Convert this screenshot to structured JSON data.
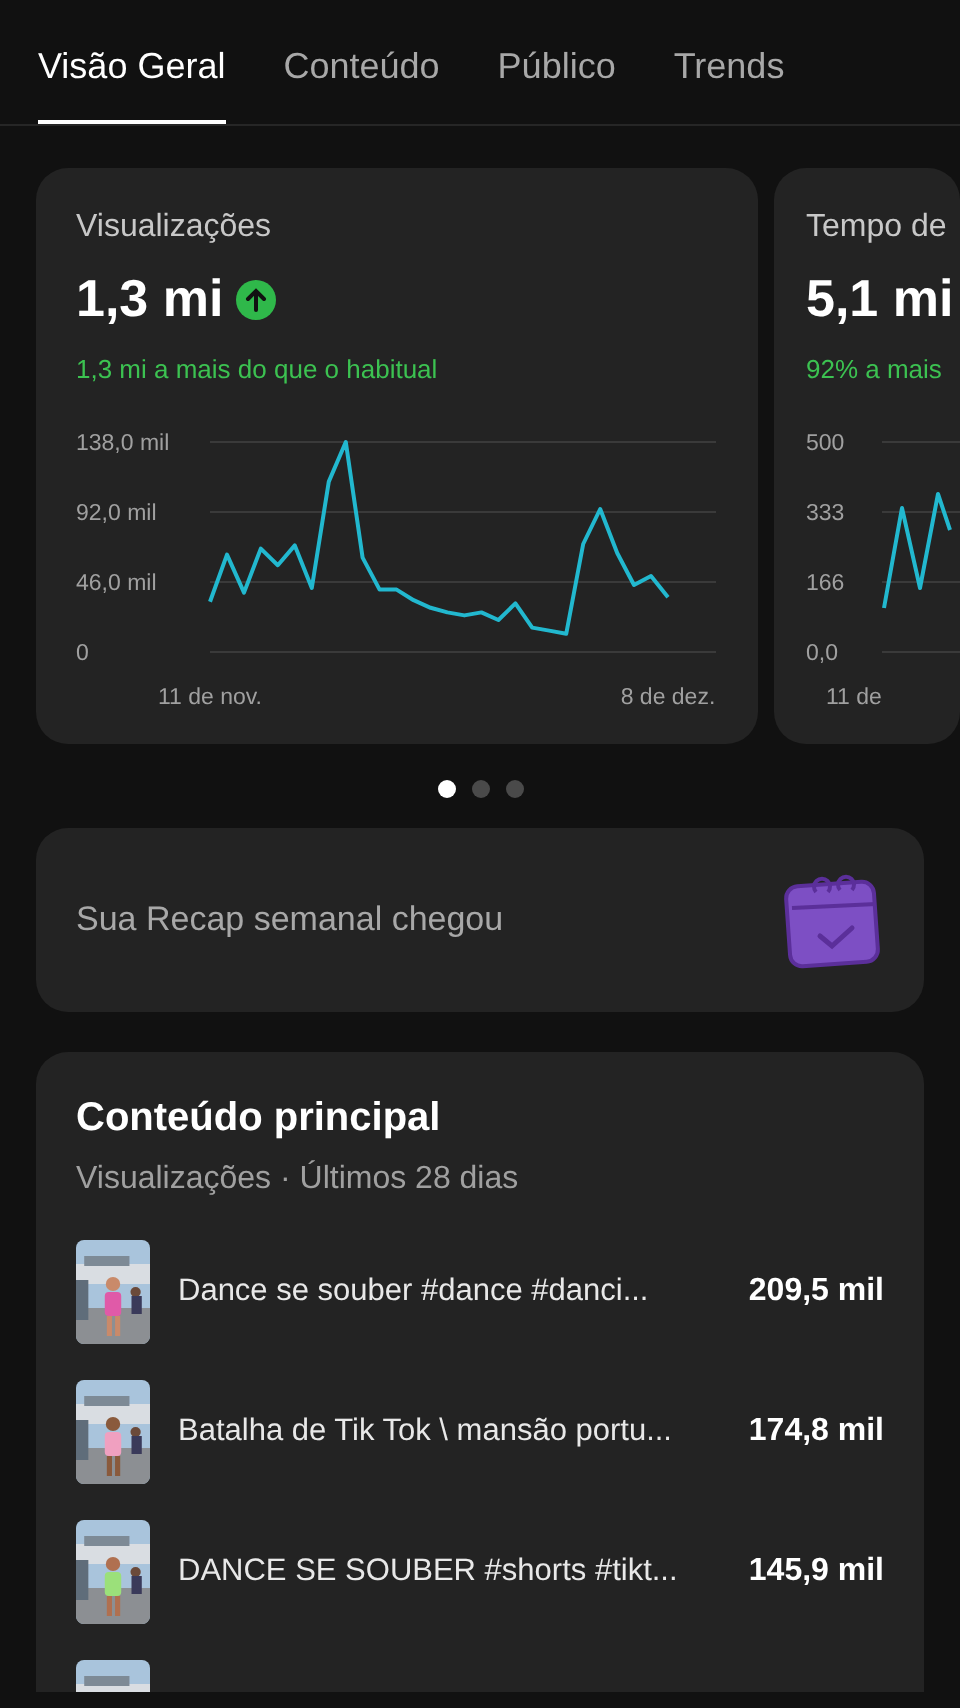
{
  "tabs": [
    {
      "label": "Visão Geral",
      "selected": true
    },
    {
      "label": "Conteúdo",
      "selected": false
    },
    {
      "label": "Público",
      "selected": false
    },
    {
      "label": "Trends",
      "selected": false
    }
  ],
  "metric_cards": [
    {
      "title": "Visualizações",
      "value": "1,3 mi",
      "trend_up": true,
      "comparison": "1,3 mi a mais do que o habitual",
      "chart_data": {
        "type": "line",
        "x": [
          "11 de nov.",
          null,
          null,
          null,
          null,
          null,
          null,
          null,
          null,
          null,
          null,
          null,
          null,
          null,
          null,
          null,
          null,
          null,
          null,
          null,
          null,
          null,
          null,
          null,
          null,
          null,
          null,
          "8 de dez."
        ],
        "ylim": [
          0,
          138
        ],
        "yticks": [
          {
            "value": 0,
            "label": "0"
          },
          {
            "value": 46,
            "label": "46,0 mil"
          },
          {
            "value": 92,
            "label": "92,0 mil"
          },
          {
            "value": 138,
            "label": "138,0 mil"
          }
        ],
        "series": [
          {
            "color": "#22b8cf",
            "values": [
              33,
              64,
              39,
              68,
              57,
              70,
              42,
              112,
              138,
              62,
              41,
              41,
              34,
              29,
              26,
              24,
              26,
              21,
              32,
              16,
              14,
              12,
              71,
              94,
              65,
              44,
              50,
              36
            ]
          }
        ]
      }
    },
    {
      "title": "Tempo de",
      "value": "5,1 mi",
      "trend_up": false,
      "comparison": "92% a mais",
      "y_labels": [
        "500",
        "333",
        "166",
        "0,0"
      ],
      "x_label": "11 de"
    }
  ],
  "pager": [
    {
      "selected": true
    },
    {
      "selected": false
    },
    {
      "selected": false
    }
  ],
  "recap": {
    "text": "Sua Recap semanal chegou"
  },
  "top_content": {
    "title": "Conteúdo principal",
    "subtitle": "Visualizações · Últimos 28 dias",
    "items": [
      {
        "kind": "video",
        "title": "Dance se souber #dance #danci...",
        "views": "209,5 mil"
      },
      {
        "kind": "video",
        "title": "Batalha de Tik Tok \\ mansão portu...",
        "views": "174,8 mil"
      },
      {
        "kind": "video",
        "title": "DANCE SE SOUBER #shorts #tikt...",
        "views": "145,9 mil"
      },
      {
        "kind": "picture"
      }
    ]
  }
}
